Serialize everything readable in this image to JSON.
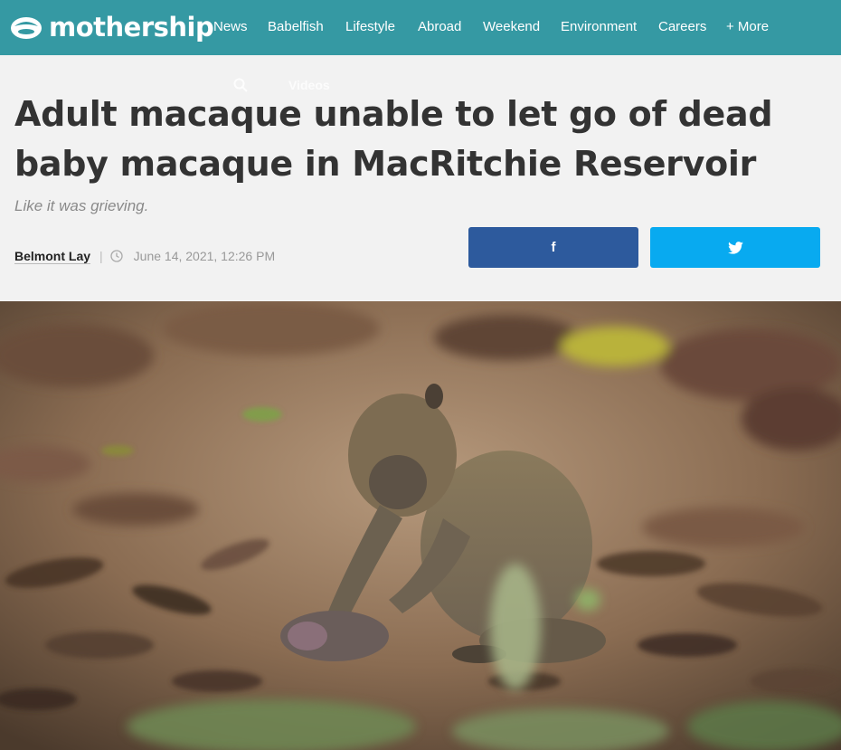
{
  "header": {
    "brand": "mothership",
    "nav": [
      "News",
      "Babelfish",
      "Lifestyle",
      "Abroad",
      "Weekend",
      "Environment",
      "Careers",
      "+ More"
    ],
    "videos_label": "Videos"
  },
  "article": {
    "title": "Adult macaque unable to let go of dead baby macaque in MacRitchie Reservoir",
    "subtitle": "Like it was grieving.",
    "author": "Belmont Lay",
    "separator": "|",
    "date": "June 14, 2021, 12:26 PM"
  },
  "share": {
    "facebook_glyph": "f"
  },
  "icons": [
    "mothership-logo-icon",
    "search-icon",
    "clock-icon",
    "facebook-icon",
    "twitter-icon"
  ],
  "colors": {
    "topbar": "#3599a3",
    "facebook": "#2d5a9d",
    "twitter": "#08aaf0",
    "headline": "#333333",
    "subtitle": "#8a8a8a"
  }
}
